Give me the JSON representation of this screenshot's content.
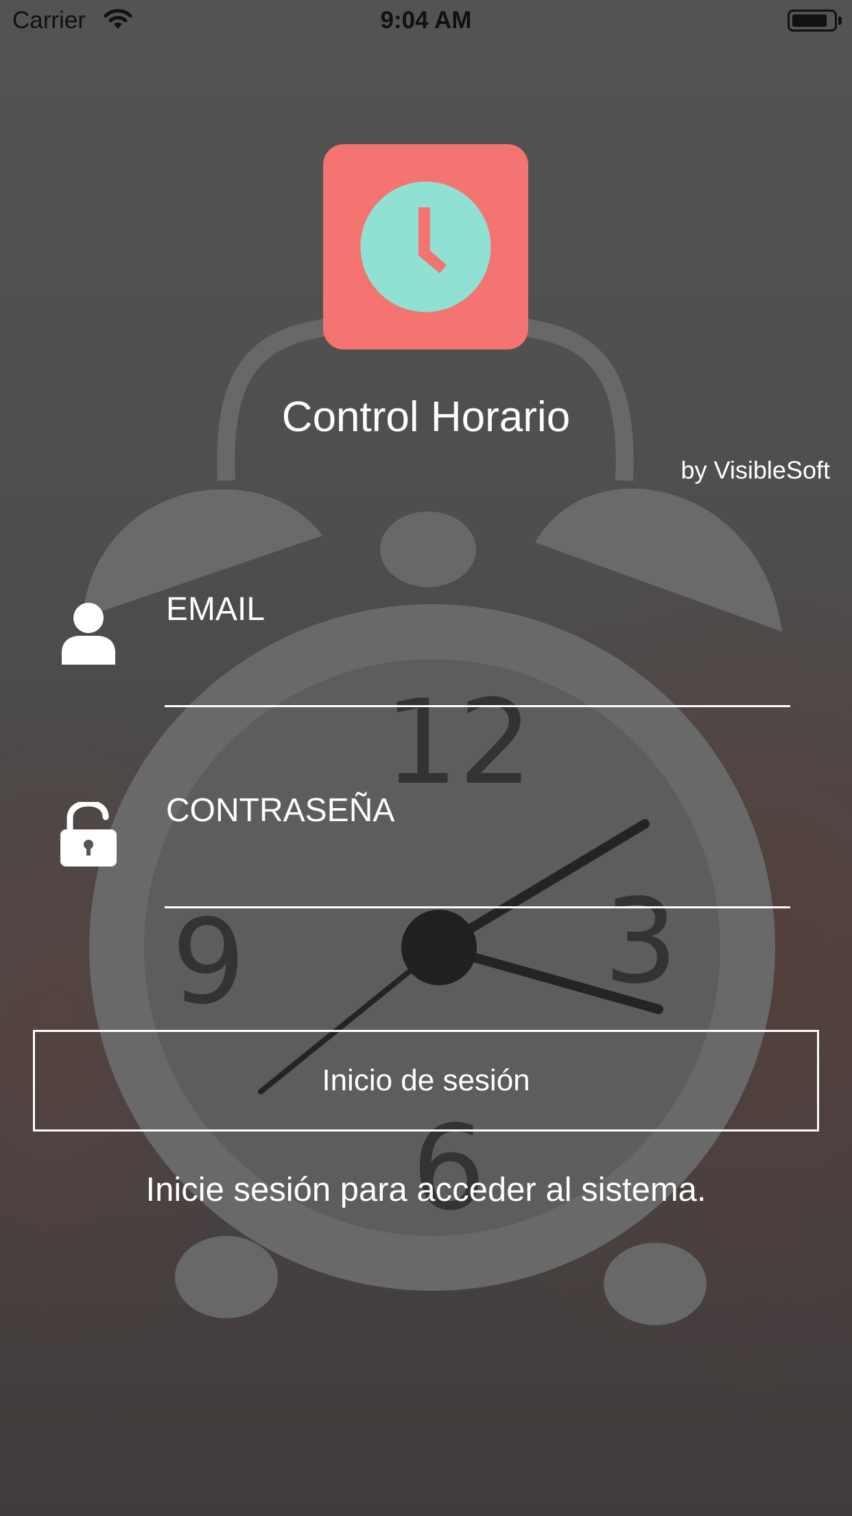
{
  "status_bar": {
    "carrier": "Carrier",
    "time": "9:04 AM",
    "icons": [
      "wifi-icon",
      "battery-icon"
    ]
  },
  "app": {
    "title": "Control Horario",
    "byline": "by VisibleSoft",
    "logo_icon": "clock-icon",
    "logo_color": "#f47472",
    "logo_clock_color": "#8fe1d3"
  },
  "form": {
    "email": {
      "label": "EMAIL",
      "icon": "user-icon"
    },
    "password": {
      "label": "CONTRASEÑA",
      "icon": "unlock-icon"
    },
    "login_button_label": "Inicio de sesión",
    "hint": "Inicie sesión para acceder al sistema."
  }
}
